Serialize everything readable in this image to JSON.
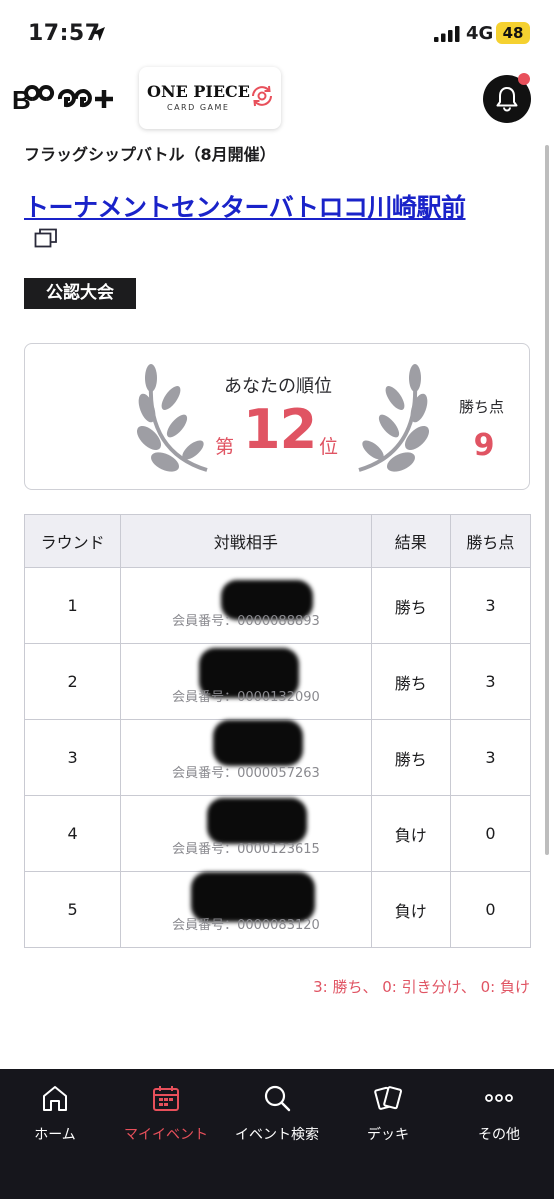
{
  "status_bar": {
    "time": "17:57",
    "network": "4G",
    "battery": "48"
  },
  "header": {
    "brand_logo": "B",
    "brand_logo_mark": "Bandai Card Games Plus logo",
    "game_logo_title": "ONE PIECE",
    "game_logo_subtitle": "CARD GAME",
    "notification_icon": "bell-icon",
    "notification_badge": true
  },
  "event": {
    "subtitle": "フラッグシップバトル（8月開催）",
    "store_name": "トーナメントセンターバトロコ川崎駅前",
    "category_badge": "公認大会"
  },
  "rank_card": {
    "label": "あなたの順位",
    "rank_prefix": "第",
    "rank": "12",
    "rank_suffix": "位",
    "points_label": "勝ち点",
    "points_value": "9"
  },
  "results_table": {
    "headers": [
      "ラウンド",
      "対戦相手",
      "結果",
      "勝ち点"
    ],
    "rows": [
      {
        "round": "1",
        "member_no": "会員番号：0000088893",
        "result": "勝ち",
        "points": "3"
      },
      {
        "round": "2",
        "member_no": "会員番号：0000132090",
        "result": "勝ち",
        "points": "3"
      },
      {
        "round": "3",
        "member_no": "会員番号：0000057263",
        "result": "勝ち",
        "points": "3"
      },
      {
        "round": "4",
        "member_no": "会員番号：0000123615",
        "result": "負け",
        "points": "0"
      },
      {
        "round": "5",
        "member_no": "会員番号：0000083120",
        "result": "負け",
        "points": "0"
      }
    ],
    "legend": "3: 勝ち、 0: 引き分け、 0: 負け"
  },
  "bottom_nav": {
    "items": [
      {
        "label": "ホーム",
        "icon": "home-icon",
        "active": false
      },
      {
        "label": "マイイベント",
        "icon": "calendar-icon",
        "active": true
      },
      {
        "label": "イベント検索",
        "icon": "search-icon",
        "active": false
      },
      {
        "label": "デッキ",
        "icon": "cards-icon",
        "active": false
      },
      {
        "label": "その他",
        "icon": "more-icon",
        "active": false
      }
    ]
  },
  "colors": {
    "accent": "#e05463",
    "link": "#1a23c9",
    "nav_bg": "#16161c"
  }
}
